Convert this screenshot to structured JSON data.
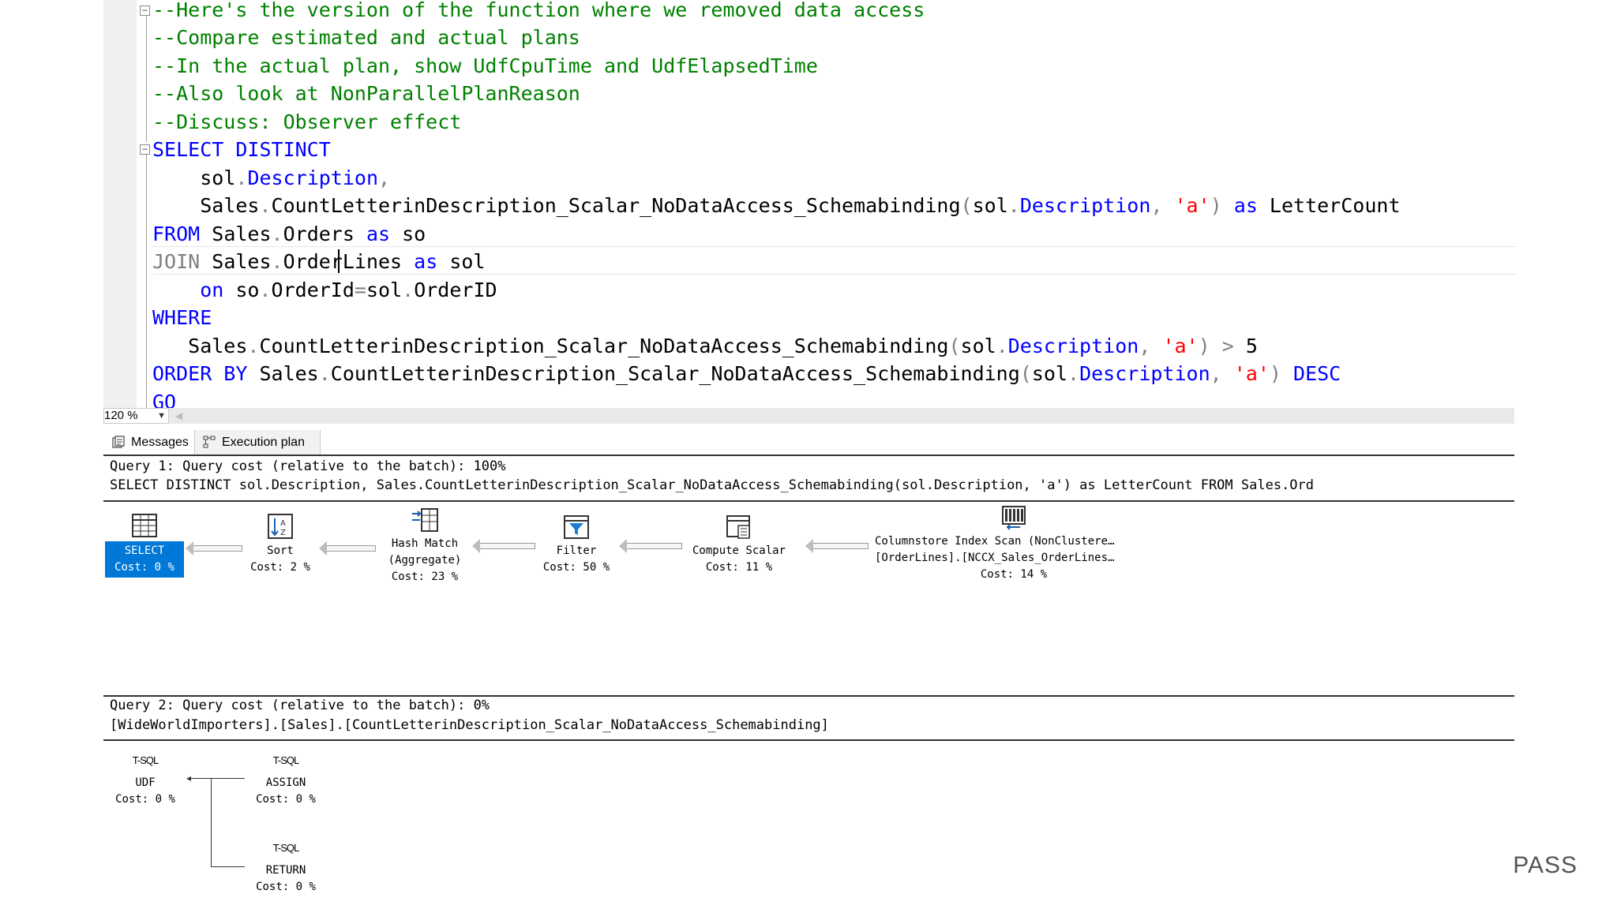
{
  "editor": {
    "lines": [
      {
        "indent": "",
        "parts": [
          {
            "t": "--Here's the version of the function where we removed data access",
            "c": "cm"
          }
        ]
      },
      {
        "indent": "",
        "parts": [
          {
            "t": "--Compare estimated and actual plans",
            "c": "cm"
          }
        ]
      },
      {
        "indent": "",
        "parts": [
          {
            "t": "--In the actual plan, show UdfCpuTime and UdfElapsedTime",
            "c": "cm"
          }
        ]
      },
      {
        "indent": "",
        "parts": [
          {
            "t": "--Also look at NonParallelPlanReason",
            "c": "cm"
          }
        ]
      },
      {
        "indent": "",
        "parts": [
          {
            "t": "--Discuss: Observer effect",
            "c": "cm"
          }
        ]
      },
      {
        "indent": "",
        "parts": [
          {
            "t": "SELECT DISTINCT",
            "c": "kw"
          }
        ]
      },
      {
        "indent": "    ",
        "parts": [
          {
            "t": "sol",
            "c": "tx"
          },
          {
            "t": ".",
            "c": "gr"
          },
          {
            "t": "Description",
            "c": "kw"
          },
          {
            "t": ",",
            "c": "gr"
          }
        ]
      },
      {
        "indent": "    ",
        "parts": [
          {
            "t": "Sales",
            "c": "tx"
          },
          {
            "t": ".",
            "c": "gr"
          },
          {
            "t": "CountLetterinDescription_Scalar_NoDataAccess_Schemabinding",
            "c": "tx"
          },
          {
            "t": "(",
            "c": "gr"
          },
          {
            "t": "sol",
            "c": "tx"
          },
          {
            "t": ".",
            "c": "gr"
          },
          {
            "t": "Description",
            "c": "kw"
          },
          {
            "t": ", ",
            "c": "gr"
          },
          {
            "t": "'a'",
            "c": "str"
          },
          {
            "t": ") ",
            "c": "gr"
          },
          {
            "t": "as",
            "c": "kw"
          },
          {
            "t": " LetterCount",
            "c": "tx"
          }
        ]
      },
      {
        "indent": "",
        "parts": [
          {
            "t": "FROM",
            "c": "kw"
          },
          {
            "t": " Sales",
            "c": "tx"
          },
          {
            "t": ".",
            "c": "gr"
          },
          {
            "t": "Orders ",
            "c": "tx"
          },
          {
            "t": "as",
            "c": "kw"
          },
          {
            "t": " so",
            "c": "tx"
          }
        ]
      },
      {
        "indent": "",
        "parts": [
          {
            "t": "JOIN",
            "c": "gr"
          },
          {
            "t": " Sales",
            "c": "tx"
          },
          {
            "t": ".",
            "c": "gr"
          },
          {
            "t": "OrderLines ",
            "c": "tx"
          },
          {
            "t": "as",
            "c": "kw"
          },
          {
            "t": " sol",
            "c": "tx"
          }
        ]
      },
      {
        "indent": "    ",
        "parts": [
          {
            "t": "on",
            "c": "kw"
          },
          {
            "t": " so",
            "c": "tx"
          },
          {
            "t": ".",
            "c": "gr"
          },
          {
            "t": "OrderId",
            "c": "tx"
          },
          {
            "t": "=",
            "c": "gr"
          },
          {
            "t": "sol",
            "c": "tx"
          },
          {
            "t": ".",
            "c": "gr"
          },
          {
            "t": "OrderID",
            "c": "tx"
          }
        ]
      },
      {
        "indent": "",
        "parts": [
          {
            "t": "WHERE",
            "c": "kw"
          }
        ]
      },
      {
        "indent": "   ",
        "parts": [
          {
            "t": "Sales",
            "c": "tx"
          },
          {
            "t": ".",
            "c": "gr"
          },
          {
            "t": "CountLetterinDescription_Scalar_NoDataAccess_Schemabinding",
            "c": "tx"
          },
          {
            "t": "(",
            "c": "gr"
          },
          {
            "t": "sol",
            "c": "tx"
          },
          {
            "t": ".",
            "c": "gr"
          },
          {
            "t": "Description",
            "c": "kw"
          },
          {
            "t": ", ",
            "c": "gr"
          },
          {
            "t": "'a'",
            "c": "str"
          },
          {
            "t": ") ",
            "c": "gr"
          },
          {
            "t": ">",
            "c": "gr"
          },
          {
            "t": " 5",
            "c": "tx"
          }
        ]
      },
      {
        "indent": "",
        "parts": [
          {
            "t": "ORDER BY",
            "c": "kw"
          },
          {
            "t": " Sales",
            "c": "tx"
          },
          {
            "t": ".",
            "c": "gr"
          },
          {
            "t": "CountLetterinDescription_Scalar_NoDataAccess_Schemabinding",
            "c": "tx"
          },
          {
            "t": "(",
            "c": "gr"
          },
          {
            "t": "sol",
            "c": "tx"
          },
          {
            "t": ".",
            "c": "gr"
          },
          {
            "t": "Description",
            "c": "kw"
          },
          {
            "t": ", ",
            "c": "gr"
          },
          {
            "t": "'a'",
            "c": "str"
          },
          {
            "t": ") ",
            "c": "gr"
          },
          {
            "t": "DESC",
            "c": "kw"
          }
        ]
      },
      {
        "indent": "",
        "parts": [
          {
            "t": "GO",
            "c": "kw"
          }
        ]
      }
    ]
  },
  "zoom": {
    "value": "120 %"
  },
  "tabs": {
    "messages": "Messages",
    "execution_plan": "Execution plan"
  },
  "query1": {
    "header": "Query 1: Query cost (relative to the batch): 100%",
    "sql": "SELECT DISTINCT sol.Description, Sales.CountLetterinDescription_Scalar_NoDataAccess_Schemabinding(sol.Description, 'a') as LetterCount FROM Sales.Ord",
    "nodes": {
      "select": {
        "name": "SELECT",
        "cost": "Cost: 0 %"
      },
      "sort": {
        "name": "Sort",
        "cost": "Cost: 2 %"
      },
      "hash": {
        "name": "Hash Match",
        "sub": "(Aggregate)",
        "cost": "Cost: 23 %"
      },
      "filter": {
        "name": "Filter",
        "cost": "Cost: 50 %"
      },
      "compute": {
        "name": "Compute Scalar",
        "cost": "Cost: 11 %"
      },
      "columnstore": {
        "name": "Columnstore Index Scan (NonClustere…",
        "sub": "[OrderLines].[NCCX_Sales_OrderLines…",
        "cost": "Cost: 14 %"
      }
    }
  },
  "query2": {
    "header": "Query 2: Query cost (relative to the batch): 0%",
    "sql": "[WideWorldImporters].[Sales].[CountLetterinDescription_Scalar_NoDataAccess_Schemabinding]",
    "nodes": {
      "udf": {
        "tag": "T-SQL",
        "name": "UDF",
        "cost": "Cost: 0 %"
      },
      "assign": {
        "tag": "T-SQL",
        "name": "ASSIGN",
        "cost": "Cost: 0 %"
      },
      "return": {
        "tag": "T-SQL",
        "name": "RETURN",
        "cost": "Cost: 0 %"
      }
    }
  },
  "brand": {
    "logo": "PASS"
  }
}
